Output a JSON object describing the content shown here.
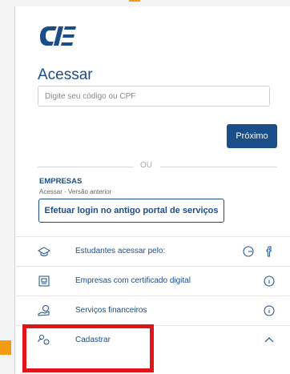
{
  "login": {
    "title": "Acessar",
    "input_placeholder": "Digite seu código ou CPF",
    "next_button": "Próximo",
    "divider": "OU"
  },
  "companies": {
    "heading": "EMPRESAS",
    "subtext": "Acessar - Versão anterior",
    "old_portal_button": "Efetuar login no antigo portal de serviços"
  },
  "options": [
    {
      "label": "Estudantes acessar pelo:",
      "icon": "graduation-cap-icon",
      "actions": [
        "google-icon",
        "facebook-icon"
      ]
    },
    {
      "label": "Empresas com certificado digital",
      "icon": "certificate-icon",
      "actions": [
        "info-icon"
      ]
    },
    {
      "label": "Serviços financeiros",
      "icon": "finance-icon",
      "actions": [
        "info-icon"
      ]
    },
    {
      "label": "Cadastrar",
      "icon": "users-icon",
      "actions": [
        "chevron-up-icon"
      ]
    }
  ],
  "colors": {
    "primary": "#1b4d89",
    "highlight": "#e01515",
    "accent": "#f39c12"
  }
}
